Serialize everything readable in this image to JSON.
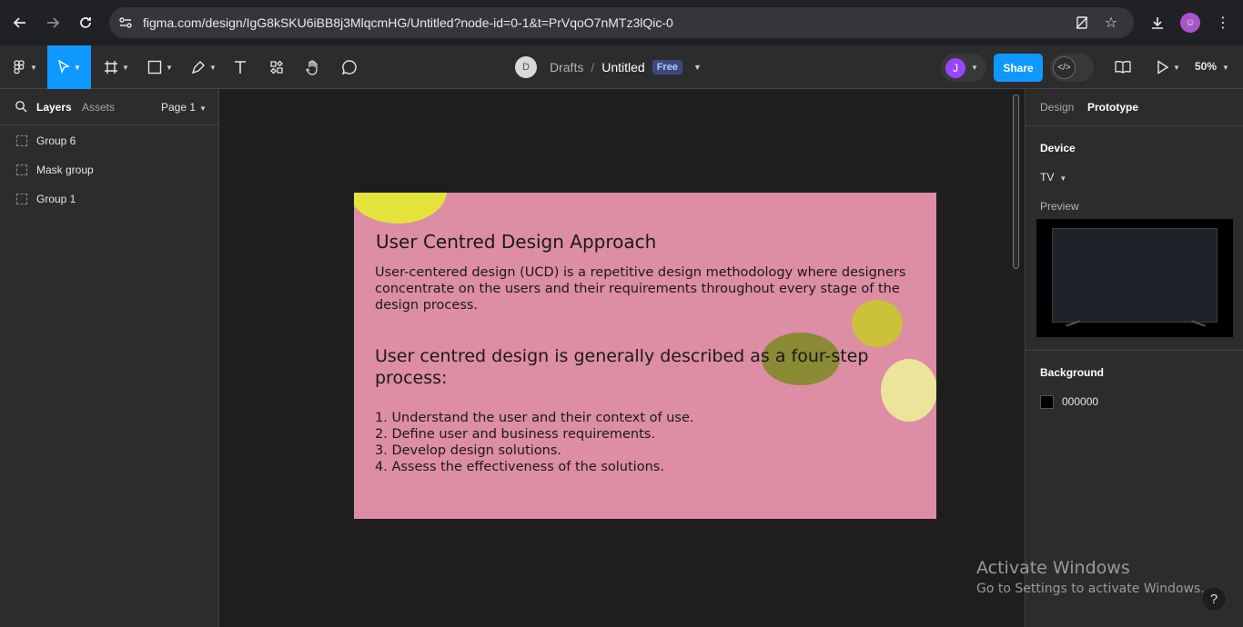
{
  "browser": {
    "url": "figma.com/design/IgG8kSKU6iBB8j3MlqcmHG/Untitled?node-id=0-1&t=PrVqoO7nMTz3lQic-0",
    "icons": [
      "back-icon",
      "forward-icon",
      "reload-icon",
      "site-settings-icon",
      "no-tracking-icon",
      "bookmark-star-icon",
      "download-icon",
      "profile-icon",
      "more-icon"
    ]
  },
  "toolbar": {
    "avatar_letter": "D",
    "crumb_project": "Drafts",
    "crumb_sep": "/",
    "file_title": "Untitled",
    "plan_badge": "Free",
    "user_letter": "J",
    "share_label": "Share",
    "zoom": "50%"
  },
  "left_panel": {
    "tabs": [
      "Layers",
      "Assets"
    ],
    "page": "Page 1",
    "layers": [
      "Group 6",
      "Mask group",
      "Group 1"
    ]
  },
  "frame": {
    "title": "User Centred Design Approach",
    "intro": "User-centered design (UCD) is a repetitive design methodology where designers concentrate on the users and their requirements throughout every stage of the design process.",
    "subheading": "User centred design is generally described as a four-step process:",
    "steps": [
      "1. Understand the user and their context of use.",
      "2. Define user and business requirements.",
      "3. Develop design solutions.",
      "4. Assess the effectiveness of the solutions."
    ],
    "colors": {
      "background": "#dd8da4",
      "blob_yellow": "#e3e33b",
      "blob_olive_light": "#c9c23a",
      "blob_olive_dark": "#8b8a35",
      "blob_cream": "#ebe49a"
    }
  },
  "right_panel": {
    "tabs": [
      "Design",
      "Prototype"
    ],
    "device_heading": "Device",
    "device_value": "TV",
    "preview_label": "Preview",
    "background_heading": "Background",
    "background_value": "000000"
  },
  "overlay": {
    "activate_title": "Activate Windows",
    "activate_sub": "Go to Settings to activate Windows.",
    "help": "?"
  }
}
